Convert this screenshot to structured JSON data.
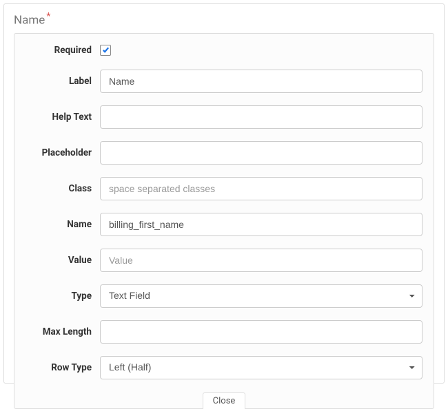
{
  "header": {
    "title": "Name",
    "asterisk": "*"
  },
  "form": {
    "required": {
      "label": "Required",
      "checked": true
    },
    "label_field": {
      "label": "Label",
      "value": "Name"
    },
    "help_text": {
      "label": "Help Text",
      "value": ""
    },
    "placeholder": {
      "label": "Placeholder",
      "value": ""
    },
    "class_field": {
      "label": "Class",
      "value": "",
      "placeholder": "space separated classes"
    },
    "name_field": {
      "label": "Name",
      "value": "billing_first_name"
    },
    "value_field": {
      "label": "Value",
      "value": "",
      "placeholder": "Value"
    },
    "type_field": {
      "label": "Type",
      "selected": "Text Field"
    },
    "max_length": {
      "label": "Max Length",
      "value": ""
    },
    "row_type": {
      "label": "Row Type",
      "selected": "Left (Half)"
    }
  },
  "actions": {
    "close": "Close"
  }
}
